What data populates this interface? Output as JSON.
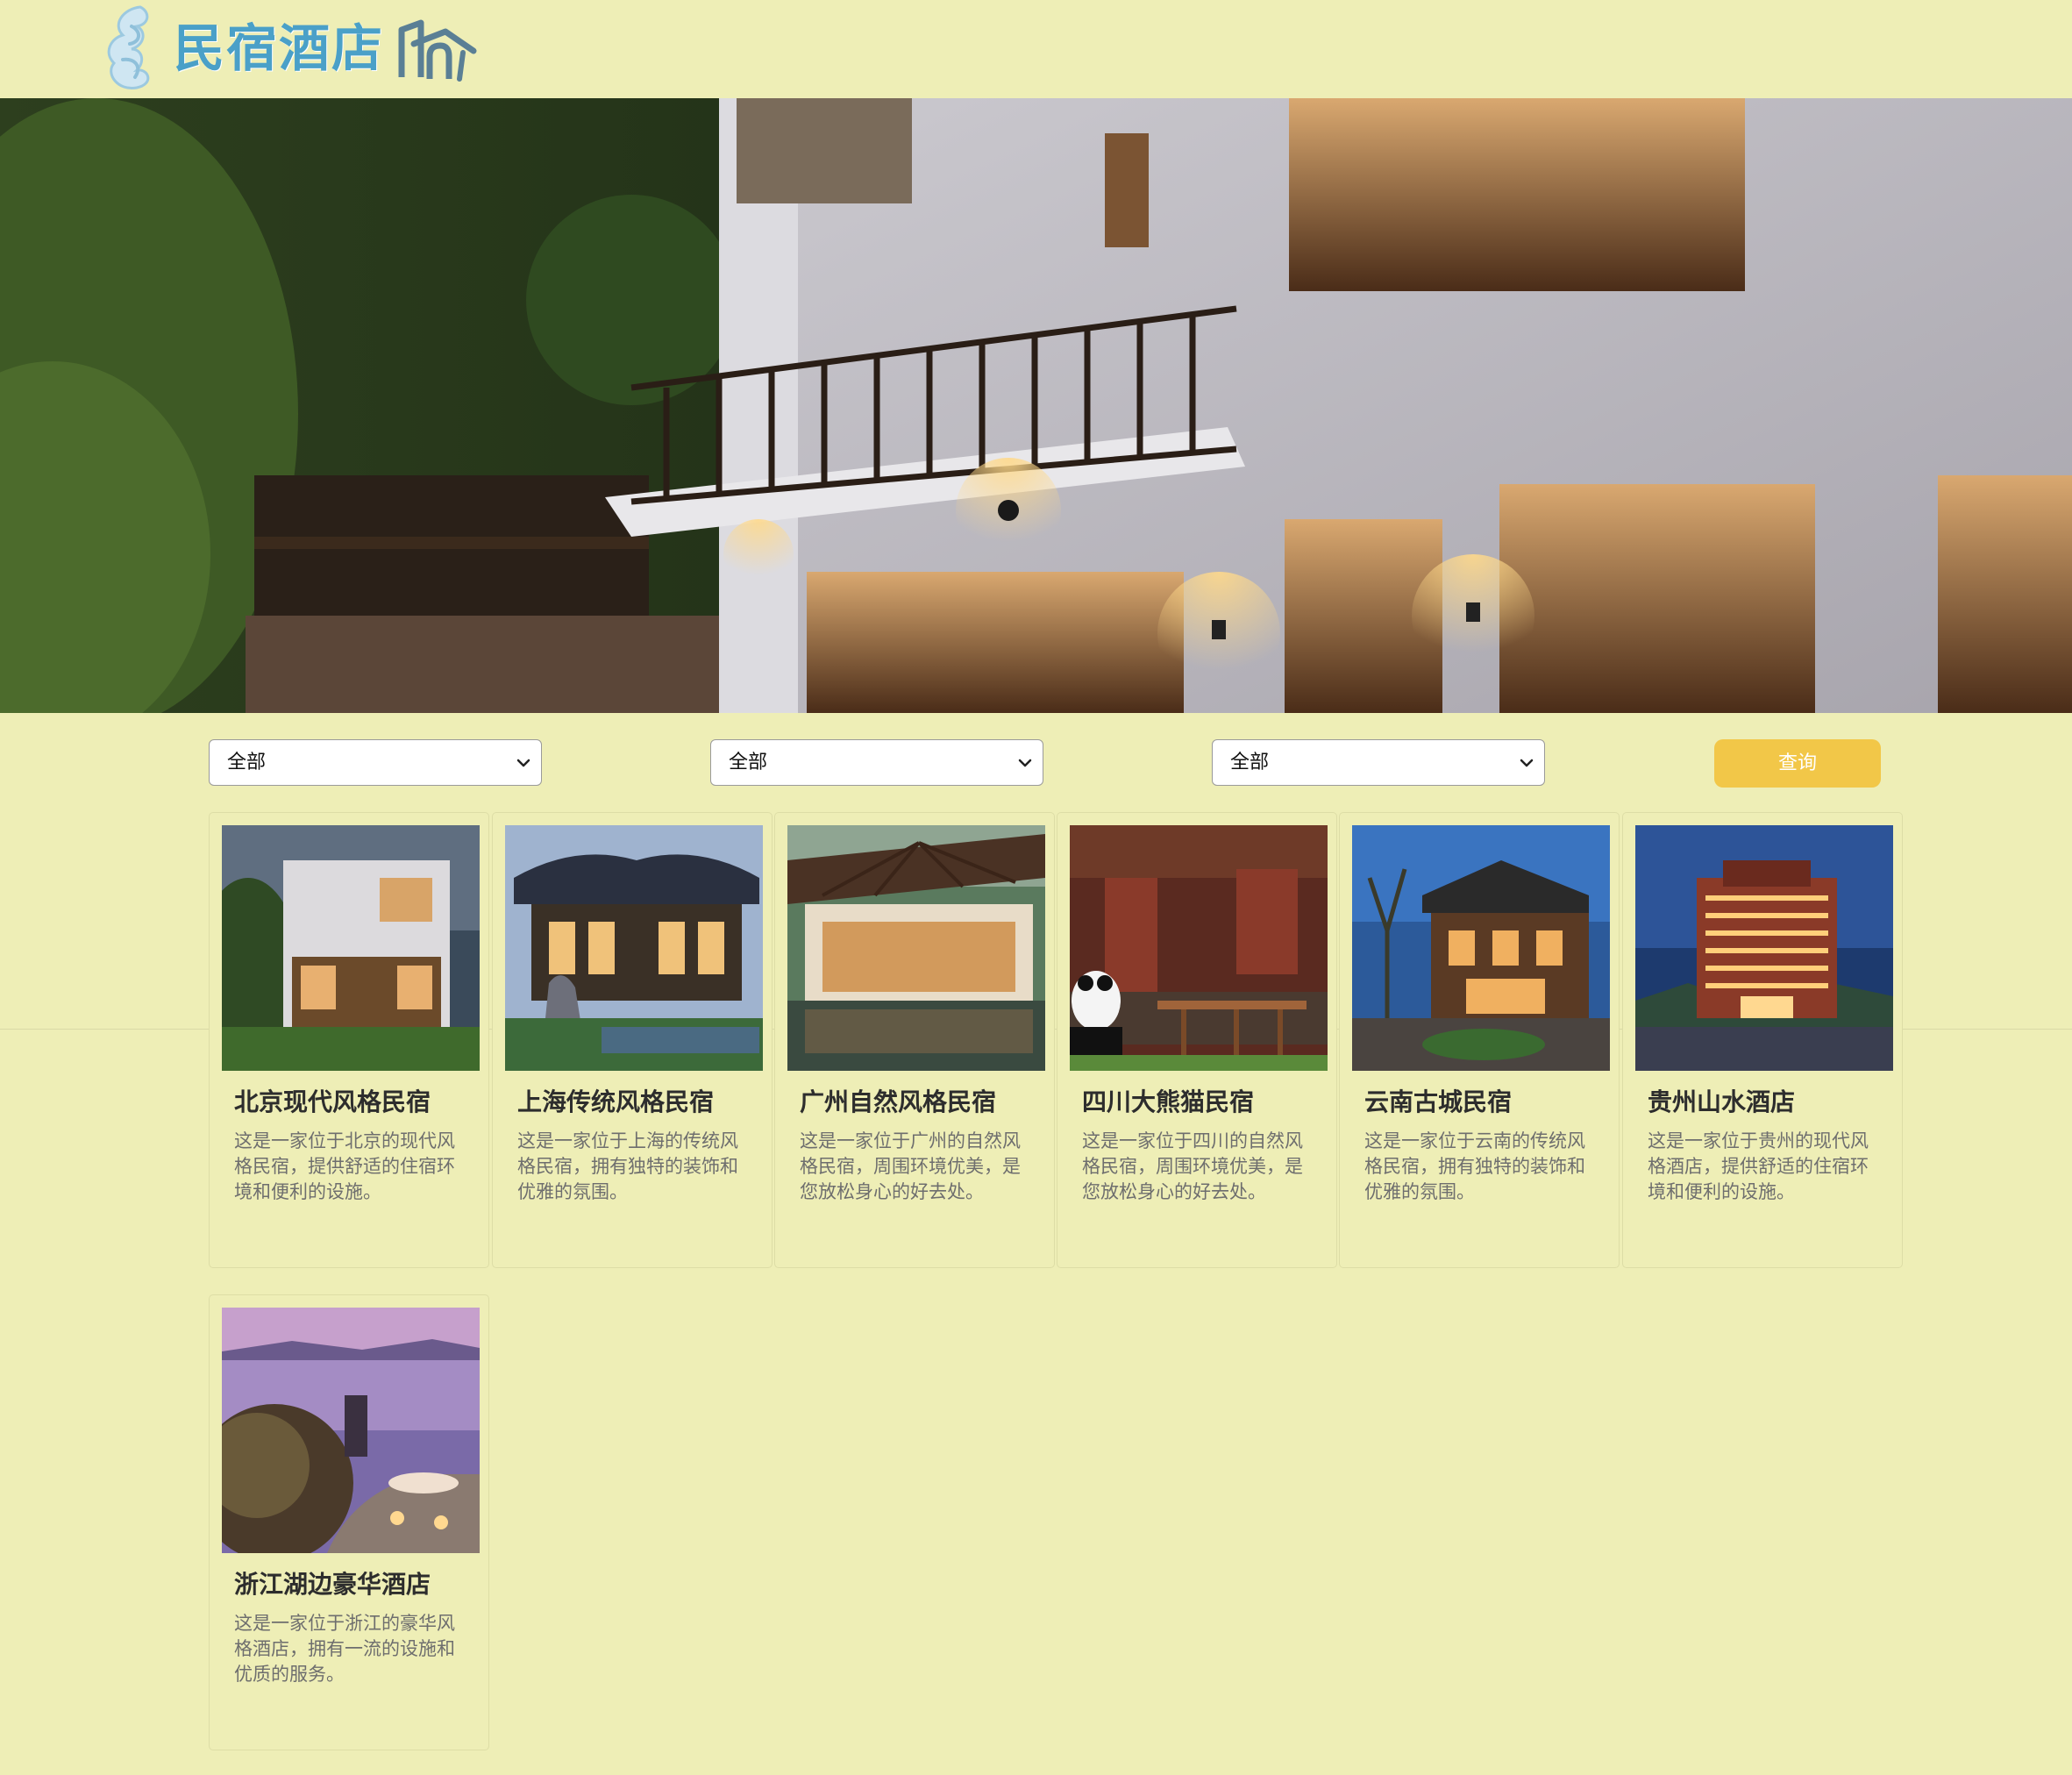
{
  "header": {
    "logo_text": "民宿酒店"
  },
  "filters": {
    "select_1": "全部",
    "select_2": "全部",
    "select_3": "全部",
    "query_label": "查询"
  },
  "cards": [
    {
      "title": "北京现代风格民宿",
      "description": "这是一家位于北京的现代风格民宿，提供舒适的住宿环境和便利的设施。"
    },
    {
      "title": "上海传统风格民宿",
      "description": "这是一家位于上海的传统风格民宿，拥有独特的装饰和优雅的氛围。"
    },
    {
      "title": "广州自然风格民宿",
      "description": "这是一家位于广州的自然风格民宿，周围环境优美，是您放松身心的好去处。"
    },
    {
      "title": "四川大熊猫民宿",
      "description": "这是一家位于四川的自然风格民宿，周围环境优美，是您放松身心的好去处。"
    },
    {
      "title": "云南古城民宿",
      "description": "这是一家位于云南的传统风格民宿，拥有独特的装饰和优雅的氛围。"
    },
    {
      "title": "贵州山水酒店",
      "description": "这是一家位于贵州的现代风格酒店，提供舒适的住宿环境和便利的设施。"
    },
    {
      "title": "浙江湖边豪华酒店",
      "description": "这是一家位于浙江的豪华风格酒店，拥有一流的设施和优质的服务。"
    }
  ],
  "colors": {
    "page_background": "#eeeeb6",
    "query_button": "#f2c748",
    "logo": "#4aa0c8"
  }
}
